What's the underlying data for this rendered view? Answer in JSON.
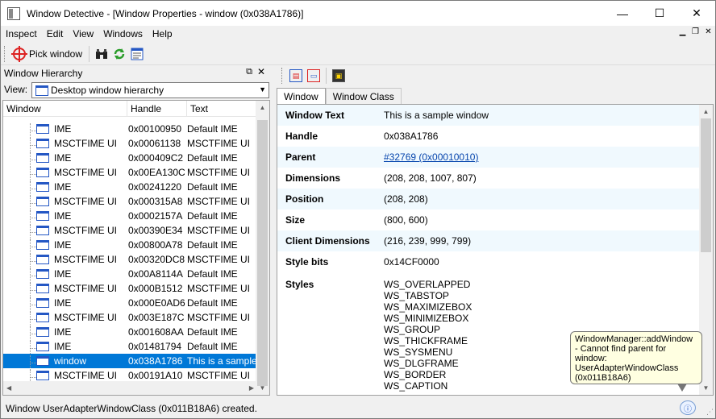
{
  "window": {
    "title": "Window Detective - [Window Properties - window (0x038A1786)]",
    "minimize": "—",
    "maximize": "☐",
    "close": "✕"
  },
  "menu": [
    "Inspect",
    "Edit",
    "View",
    "Windows",
    "Help"
  ],
  "toolbar": {
    "pick_window": "Pick window"
  },
  "hierarchy": {
    "title": "Window Hierarchy",
    "view_label": "View:",
    "view_value": "Desktop window hierarchy",
    "columns": [
      "Window",
      "Handle",
      "Text"
    ],
    "rows": [
      {
        "window": "IME",
        "handle": "0x00100950",
        "text": "Default IME"
      },
      {
        "window": "MSCTFIME UI",
        "handle": "0x00061138",
        "text": "MSCTFIME UI"
      },
      {
        "window": "IME",
        "handle": "0x000409C2",
        "text": "Default IME"
      },
      {
        "window": "MSCTFIME UI",
        "handle": "0x00EA130C",
        "text": "MSCTFIME UI"
      },
      {
        "window": "IME",
        "handle": "0x00241220",
        "text": "Default IME"
      },
      {
        "window": "MSCTFIME UI",
        "handle": "0x000315A8",
        "text": "MSCTFIME UI"
      },
      {
        "window": "IME",
        "handle": "0x0002157A",
        "text": "Default IME"
      },
      {
        "window": "MSCTFIME UI",
        "handle": "0x00390E34",
        "text": "MSCTFIME UI"
      },
      {
        "window": "IME",
        "handle": "0x00800A78",
        "text": "Default IME"
      },
      {
        "window": "MSCTFIME UI",
        "handle": "0x00320DC8",
        "text": "MSCTFIME UI"
      },
      {
        "window": "IME",
        "handle": "0x00A8114A",
        "text": "Default IME"
      },
      {
        "window": "MSCTFIME UI",
        "handle": "0x000B1512",
        "text": "MSCTFIME UI"
      },
      {
        "window": "IME",
        "handle": "0x000E0AD6",
        "text": "Default IME"
      },
      {
        "window": "MSCTFIME UI",
        "handle": "0x003E187C",
        "text": "MSCTFIME UI"
      },
      {
        "window": "IME",
        "handle": "0x001608AA",
        "text": "Default IME"
      },
      {
        "window": "IME",
        "handle": "0x01481794",
        "text": "Default IME"
      },
      {
        "window": "window",
        "handle": "0x038A1786",
        "text": "This is a sample",
        "selected": true
      },
      {
        "window": "MSCTFIME UI",
        "handle": "0x00191A10",
        "text": "MSCTFIME UI"
      }
    ]
  },
  "properties": {
    "tabs": [
      "Window",
      "Window Class"
    ],
    "active_tab": "Window",
    "fields": [
      {
        "key": "Window Text",
        "value": "This is a sample window"
      },
      {
        "key": "Handle",
        "value": "0x038A1786"
      },
      {
        "key": "Parent",
        "value": "#32769 (0x00010010)",
        "link": true
      },
      {
        "key": "Dimensions",
        "value": "(208, 208, 1007, 807)"
      },
      {
        "key": "Position",
        "value": "(208, 208)"
      },
      {
        "key": "Size",
        "value": "(800, 600)"
      },
      {
        "key": "Client Dimensions",
        "value": "(216, 239, 999, 799)"
      },
      {
        "key": "Style bits",
        "value": "0x14CF0000"
      }
    ],
    "styles_label": "Styles",
    "styles": [
      "WS_OVERLAPPED",
      "WS_TABSTOP",
      "WS_MAXIMIZEBOX",
      "WS_MINIMIZEBOX",
      "WS_GROUP",
      "WS_THICKFRAME",
      "WS_SYSMENU",
      "WS_DLGFRAME",
      "WS_BORDER",
      "WS_CAPTION"
    ]
  },
  "tooltip": {
    "text": "WindowManager::addWindow - Cannot find parent for window: UserAdapterWindowClass (0x011B18A6)"
  },
  "status": {
    "text": "Window UserAdapterWindowClass (0x011B18A6) created."
  }
}
